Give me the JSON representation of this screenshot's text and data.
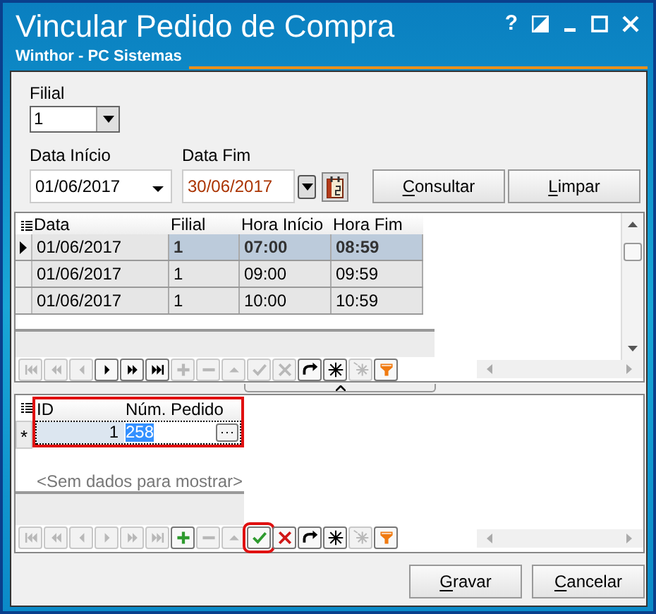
{
  "window": {
    "title": "Vincular Pedido de Compra",
    "subtitle": "Winthor - PC Sistemas",
    "help": "?"
  },
  "filial": {
    "label": "Filial",
    "value": "1"
  },
  "data_inicio": {
    "label": "Data Início",
    "value": "01/06/2017"
  },
  "data_fim": {
    "label": "Data Fim",
    "value": "30/06/2017"
  },
  "buttons_top": [
    {
      "label": "Consultar"
    },
    {
      "label": "Limpar"
    }
  ],
  "grid_1": {
    "columns": [
      "Data",
      "Filial",
      "Hora Início",
      "Hora Fim"
    ],
    "rows": [
      {
        "cells": [
          "01/06/2017",
          "1",
          "07:00",
          "08:59"
        ],
        "selected": true
      },
      {
        "cells": [
          "01/06/2017",
          "1",
          "09:00",
          "09:59"
        ],
        "selected": false
      },
      {
        "cells": [
          "01/06/2017",
          "1",
          "10:00",
          "10:59"
        ],
        "selected": false
      }
    ],
    "navigator": [
      {
        "kind": "first",
        "disabled": true
      },
      {
        "kind": "prior-page",
        "disabled": true
      },
      {
        "kind": "prior",
        "disabled": true
      },
      {
        "kind": "next",
        "disabled": false
      },
      {
        "kind": "next-page",
        "disabled": false
      },
      {
        "kind": "last",
        "disabled": false
      },
      {
        "kind": "insert",
        "disabled": true
      },
      {
        "kind": "delete",
        "disabled": true
      },
      {
        "kind": "edit",
        "disabled": true
      },
      {
        "kind": "post",
        "disabled": true,
        "highlighted": false
      },
      {
        "kind": "cancel",
        "disabled": true
      },
      {
        "kind": "refresh",
        "disabled": false
      },
      {
        "kind": "bookmark",
        "disabled": false
      },
      {
        "kind": "goto-bookmark",
        "disabled": true
      },
      {
        "kind": "filter",
        "disabled": false
      }
    ]
  },
  "grid_2": {
    "highlighted": true,
    "columns": [
      "ID",
      "Núm. Pedido"
    ],
    "new_row": {
      "indicator": "*",
      "id": "1",
      "num_pedido": "258"
    },
    "empty_text": "<Sem dados para mostrar>",
    "navigator": [
      {
        "kind": "first",
        "disabled": true
      },
      {
        "kind": "prior-page",
        "disabled": true
      },
      {
        "kind": "prior",
        "disabled": true
      },
      {
        "kind": "next",
        "disabled": true
      },
      {
        "kind": "next-page",
        "disabled": true
      },
      {
        "kind": "last",
        "disabled": true
      },
      {
        "kind": "insert",
        "disabled": false
      },
      {
        "kind": "delete",
        "disabled": true
      },
      {
        "kind": "edit",
        "disabled": true
      },
      {
        "kind": "post",
        "disabled": false,
        "highlighted": true
      },
      {
        "kind": "cancel",
        "disabled": false
      },
      {
        "kind": "refresh",
        "disabled": false
      },
      {
        "kind": "bookmark",
        "disabled": false
      },
      {
        "kind": "goto-bookmark",
        "disabled": true
      },
      {
        "kind": "filter",
        "disabled": false
      }
    ]
  },
  "buttons_bottom": [
    {
      "label": "Gravar"
    },
    {
      "label": "Cancelar"
    }
  ]
}
